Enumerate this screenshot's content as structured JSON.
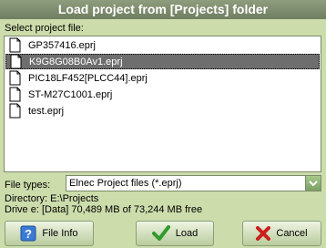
{
  "dialog": {
    "title": "Load project from [Projects] folder",
    "select_label": "Select project file:",
    "files": [
      {
        "name": "GP357416.eprj"
      },
      {
        "name": "K9G8G08B0Av1.eprj"
      },
      {
        "name": "PIC18LF452[PLCC44].eprj"
      },
      {
        "name": "ST-M27C1001.eprj"
      },
      {
        "name": "test.eprj"
      }
    ],
    "selected_file": "K9G8G08B0Av1.eprj",
    "file_types_label": "File types:",
    "file_types_value": "Elnec Project files (*.eprj)",
    "directory": "Directory: E:\\Projects",
    "drive": "Drive e: [Data]  70,489 MB of 73,244 MB free",
    "buttons": {
      "file_info": "File Info",
      "load": "Load",
      "cancel": "Cancel"
    },
    "colors": {
      "background": "#ccdcab",
      "titlebar": "#7a8a6a",
      "selection": "#6e6e6e"
    },
    "icons": [
      "document-icon",
      "help-icon",
      "checkmark-icon",
      "cancel-x-icon",
      "chevron-down-icon"
    ]
  }
}
